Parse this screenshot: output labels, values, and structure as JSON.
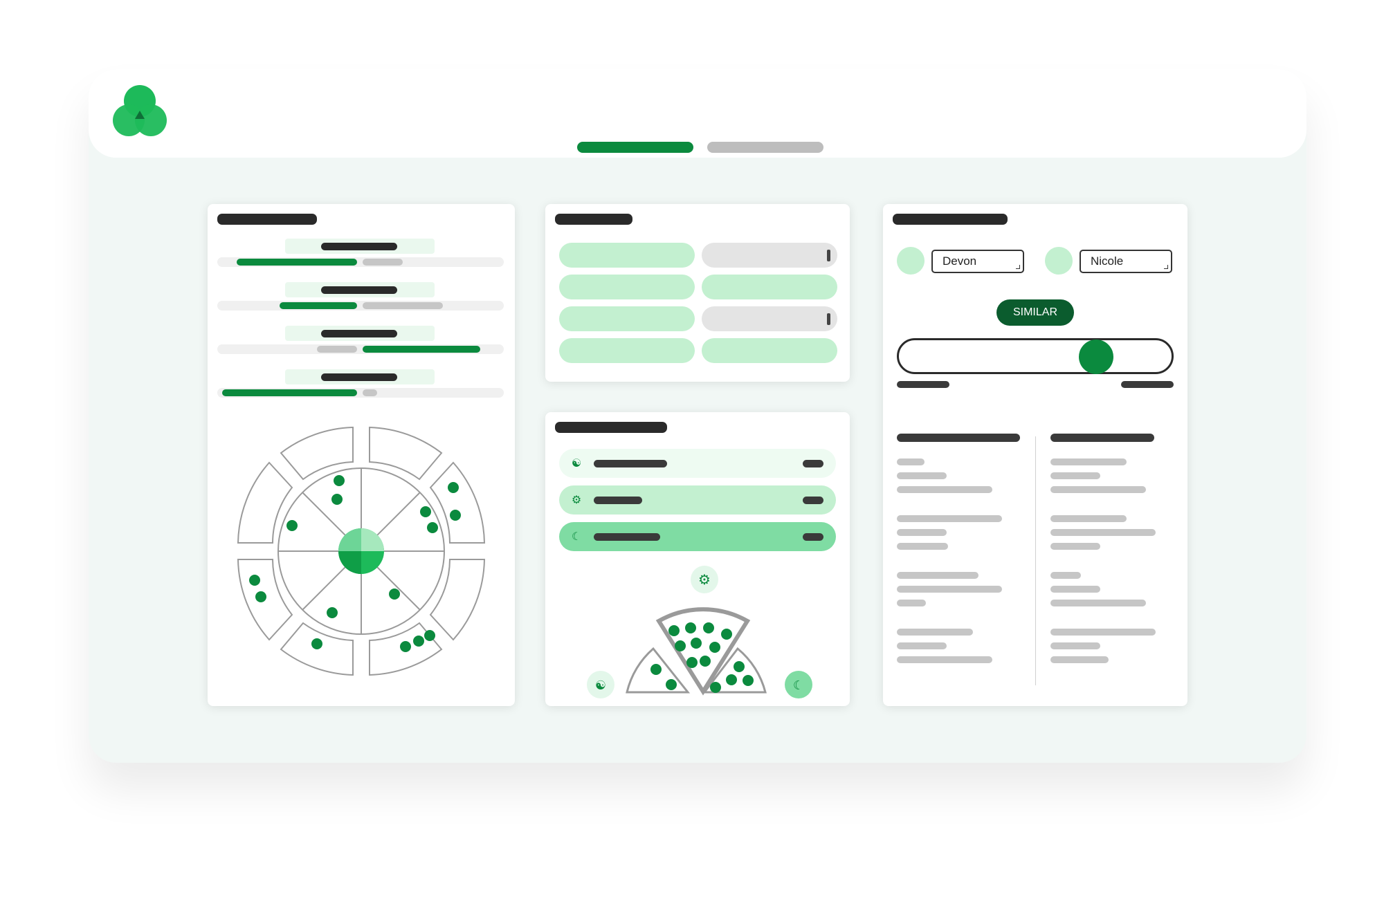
{
  "app": {
    "logo": "three-circles-logo"
  },
  "nav": {
    "tabs": [
      {
        "state": "active"
      },
      {
        "state": "inactive"
      }
    ]
  },
  "progress_card": {
    "rows": [
      {
        "green_fraction": 0.42,
        "gray_fraction": 0.14
      },
      {
        "green_fraction": 0.27,
        "gray_fraction": 0.28
      },
      {
        "green_fraction": 0.41,
        "gray_fraction": 0.14
      },
      {
        "green_fraction": 0.47,
        "gray_fraction": 0.05
      }
    ]
  },
  "pairs_card": {
    "rows": [
      {
        "left": "matched",
        "right": "empty"
      },
      {
        "left": "matched",
        "right": "matched"
      },
      {
        "left": "matched",
        "right": "empty"
      },
      {
        "left": "matched",
        "right": "matched"
      }
    ]
  },
  "ranking_card": {
    "rows": [
      {
        "icon": "users-icon",
        "level": "light"
      },
      {
        "icon": "gear-icon",
        "level": "medium"
      },
      {
        "icon": "moon-icon",
        "level": "strong"
      }
    ],
    "legend_icons": [
      "gear-icon",
      "users-icon",
      "moon-icon"
    ]
  },
  "compare_card": {
    "person_a": "Devon",
    "person_b": "Nicole",
    "button_label": "SIMILAR",
    "similarity": 0.75
  },
  "colors": {
    "accent": "#0b8a3e",
    "dark_accent": "#0b5c2e",
    "light_accent": "#c3f0d0",
    "mid_accent": "#7fdca3",
    "bg": "#f1f7f5"
  }
}
